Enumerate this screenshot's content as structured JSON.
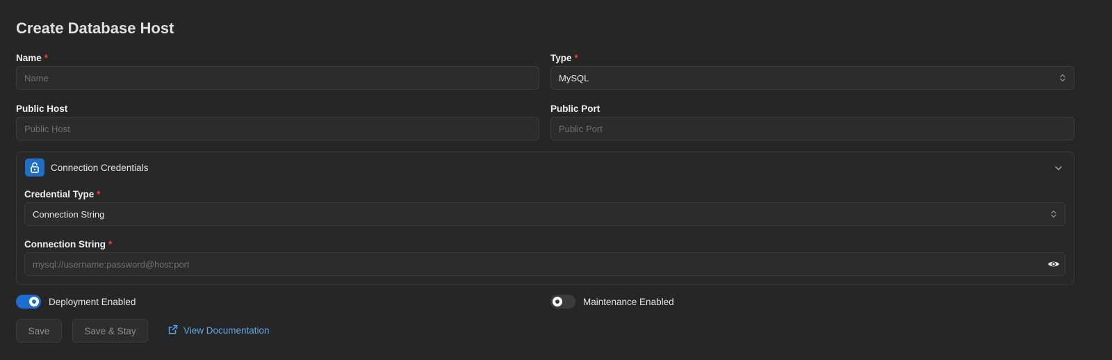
{
  "page": {
    "title": "Create Database Host"
  },
  "form": {
    "name": {
      "label": "Name",
      "required_mark": "*",
      "placeholder": "Name",
      "value": ""
    },
    "type": {
      "label": "Type",
      "required_mark": "*",
      "value": "MySQL"
    },
    "public_host": {
      "label": "Public Host",
      "placeholder": "Public Host",
      "value": ""
    },
    "public_port": {
      "label": "Public Port",
      "placeholder": "Public Port",
      "value": ""
    }
  },
  "credentials": {
    "section_title": "Connection Credentials",
    "credential_type": {
      "label": "Credential Type",
      "required_mark": "*",
      "value": "Connection String"
    },
    "connection_string": {
      "label": "Connection String",
      "required_mark": "*",
      "placeholder": "mysql://username:password@host:port",
      "value": ""
    }
  },
  "toggles": {
    "deployment": {
      "label": "Deployment Enabled",
      "on": true
    },
    "maintenance": {
      "label": "Maintenance Enabled",
      "on": false
    }
  },
  "actions": {
    "save_label": "Save",
    "save_stay_label": "Save & Stay",
    "docs_label": "View Documentation"
  },
  "colors": {
    "background": "#262626",
    "accent": "#1d6ed1",
    "link": "#5aa9f0",
    "required": "#ef4444"
  },
  "icons": {
    "section": "unlock-icon",
    "collapse": "chevron-down-icon",
    "reveal": "eye-icon",
    "external": "external-link-icon",
    "select": "chevron-updown-icon"
  }
}
